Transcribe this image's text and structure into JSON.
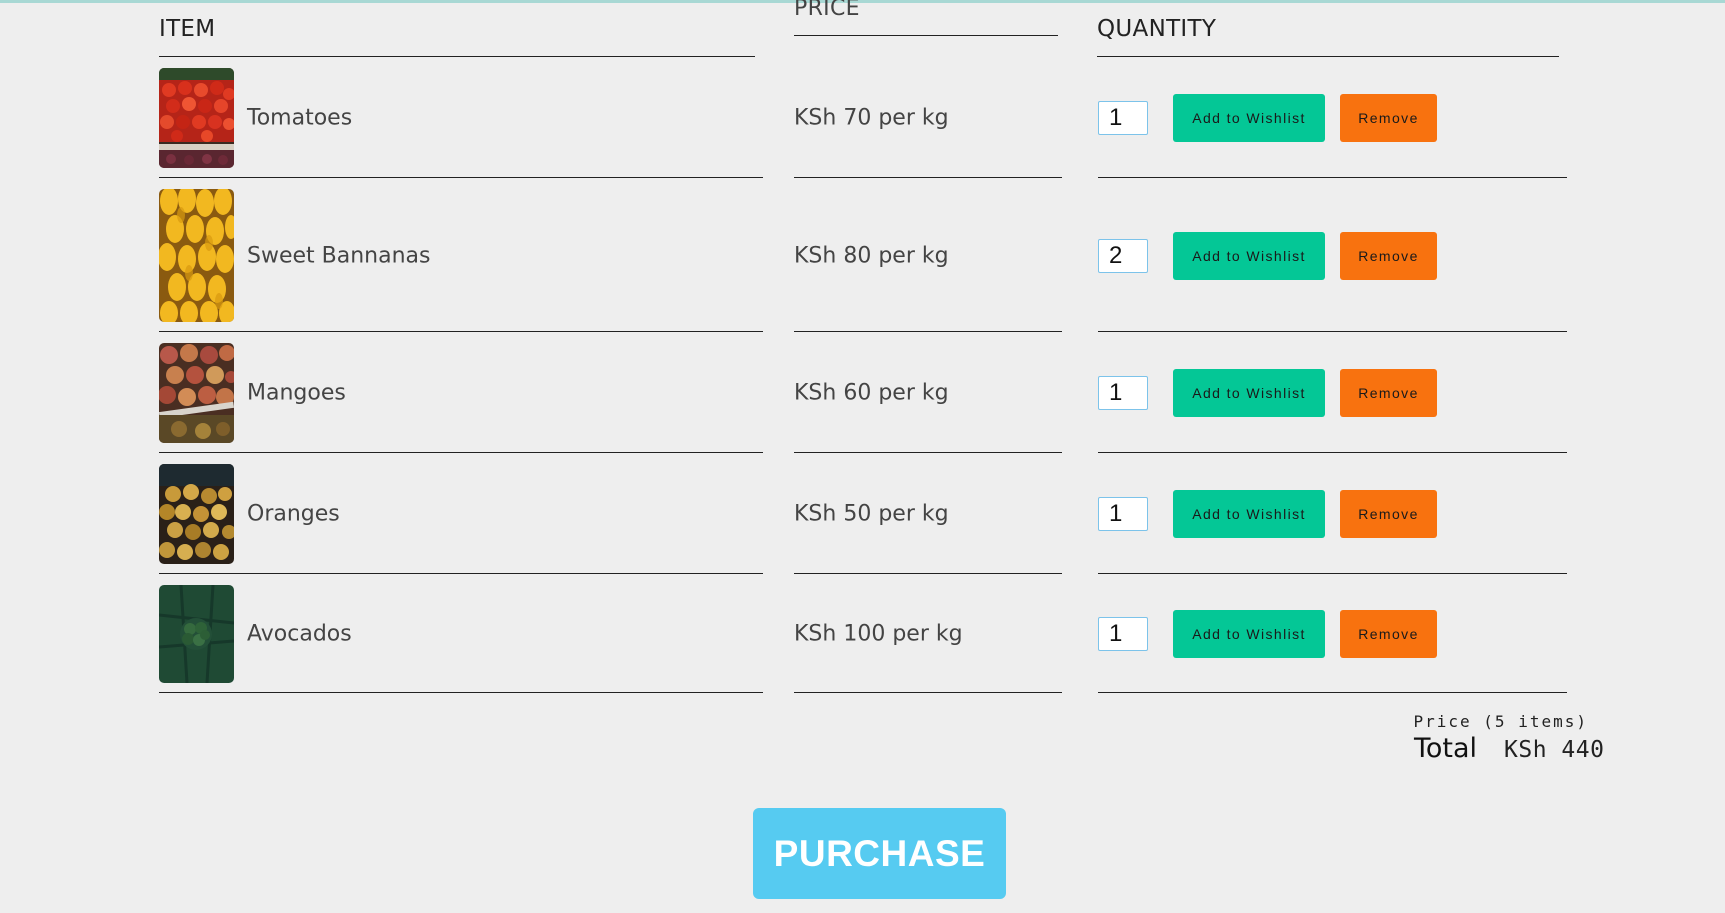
{
  "headers": {
    "item": "ITEM",
    "price": "PRICE",
    "quantity": "QUANTITY"
  },
  "items": [
    {
      "name": "Tomatoes",
      "price": "KSh 70 per kg",
      "quantity": "1",
      "image": "tomatoes-photo"
    },
    {
      "name": "Sweet Bannanas",
      "price": "KSh 80 per kg",
      "quantity": "2",
      "image": "bananas-photo"
    },
    {
      "name": "Mangoes",
      "price": "KSh 60 per kg",
      "quantity": "1",
      "image": "mangoes-photo"
    },
    {
      "name": "Oranges",
      "price": "KSh 50 per kg",
      "quantity": "1",
      "image": "oranges-photo"
    },
    {
      "name": "Avocados",
      "price": "KSh 100 per kg",
      "quantity": "1",
      "image": "avocados-photo"
    }
  ],
  "buttons": {
    "wishlist_label": "Add to Wishlist",
    "remove_label": "Remove",
    "purchase_label": "PURCHASE"
  },
  "summary": {
    "price_label": "Price (5 items)",
    "total_label": "Total",
    "total_value": "KSh 440"
  },
  "colors": {
    "background": "#eeeeee",
    "wishlist_button": "#04c796",
    "remove_button": "#f8720f",
    "purchase_button": "#56cbf1",
    "qty_border": "#7cc3ea"
  }
}
